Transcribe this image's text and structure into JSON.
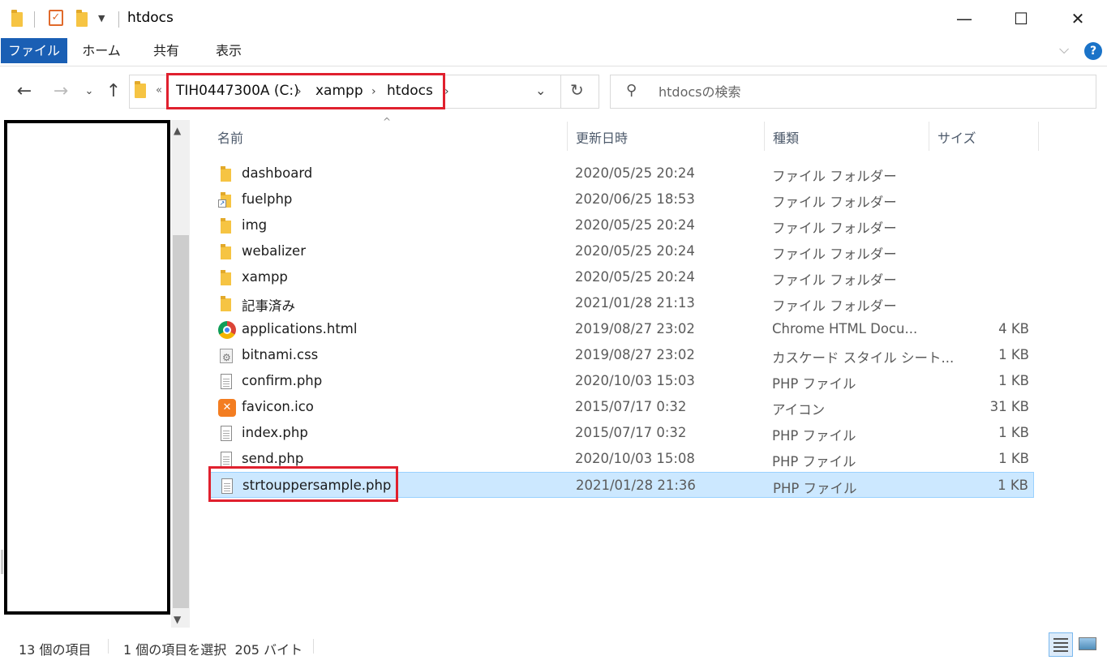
{
  "window": {
    "title": "htdocs",
    "controls": {
      "minimize": "—",
      "maximize": "☐",
      "close": "✕"
    }
  },
  "ribbon": {
    "tabs": [
      "ファイル",
      "ホーム",
      "共有",
      "表示"
    ],
    "help": "?"
  },
  "address": {
    "overflow": "«",
    "crumbs": [
      "TIH0447300A (C:)",
      "xampp",
      "htdocs"
    ]
  },
  "search": {
    "placeholder": "htdocsの検索"
  },
  "columns": {
    "name": "名前",
    "date": "更新日時",
    "type": "種類",
    "size": "サイズ"
  },
  "files": [
    {
      "name": "dashboard",
      "date": "2020/05/25 20:24",
      "type": "ファイル フォルダー",
      "size": "",
      "icon": "folder-icon"
    },
    {
      "name": "fuelphp",
      "date": "2020/06/25 18:53",
      "type": "ファイル フォルダー",
      "size": "",
      "icon": "shortcut-icon"
    },
    {
      "name": "img",
      "date": "2020/05/25 20:24",
      "type": "ファイル フォルダー",
      "size": "",
      "icon": "folder-icon"
    },
    {
      "name": "webalizer",
      "date": "2020/05/25 20:24",
      "type": "ファイル フォルダー",
      "size": "",
      "icon": "folder-icon"
    },
    {
      "name": "xampp",
      "date": "2020/05/25 20:24",
      "type": "ファイル フォルダー",
      "size": "",
      "icon": "folder-icon"
    },
    {
      "name": "記事済み",
      "date": "2021/01/28 21:13",
      "type": "ファイル フォルダー",
      "size": "",
      "icon": "folder-icon"
    },
    {
      "name": "applications.html",
      "date": "2019/08/27 23:02",
      "type": "Chrome HTML Docu...",
      "size": "4 KB",
      "icon": "chrome-icon"
    },
    {
      "name": "bitnami.css",
      "date": "2019/08/27 23:02",
      "type": "カスケード スタイル シート...",
      "size": "1 KB",
      "icon": "css-file-icon"
    },
    {
      "name": "confirm.php",
      "date": "2020/10/03 15:03",
      "type": "PHP ファイル",
      "size": "1 KB",
      "icon": "document-icon"
    },
    {
      "name": "favicon.ico",
      "date": "2015/07/17 0:32",
      "type": "アイコン",
      "size": "31 KB",
      "icon": "xampp-icon"
    },
    {
      "name": "index.php",
      "date": "2015/07/17 0:32",
      "type": "PHP ファイル",
      "size": "1 KB",
      "icon": "document-icon"
    },
    {
      "name": "send.php",
      "date": "2020/10/03 15:08",
      "type": "PHP ファイル",
      "size": "1 KB",
      "icon": "document-icon"
    },
    {
      "name": "strtouppersample.php",
      "date": "2021/01/28 21:36",
      "type": "PHP ファイル",
      "size": "1 KB",
      "icon": "document-icon",
      "selected": true
    }
  ],
  "status": {
    "count": "13 個の項目",
    "selection": "1 個の項目を選択  205 バイト"
  },
  "colors": {
    "accent": "#1a5fb4",
    "selection": "#cce8ff",
    "highlight_box": "#e0202e"
  }
}
